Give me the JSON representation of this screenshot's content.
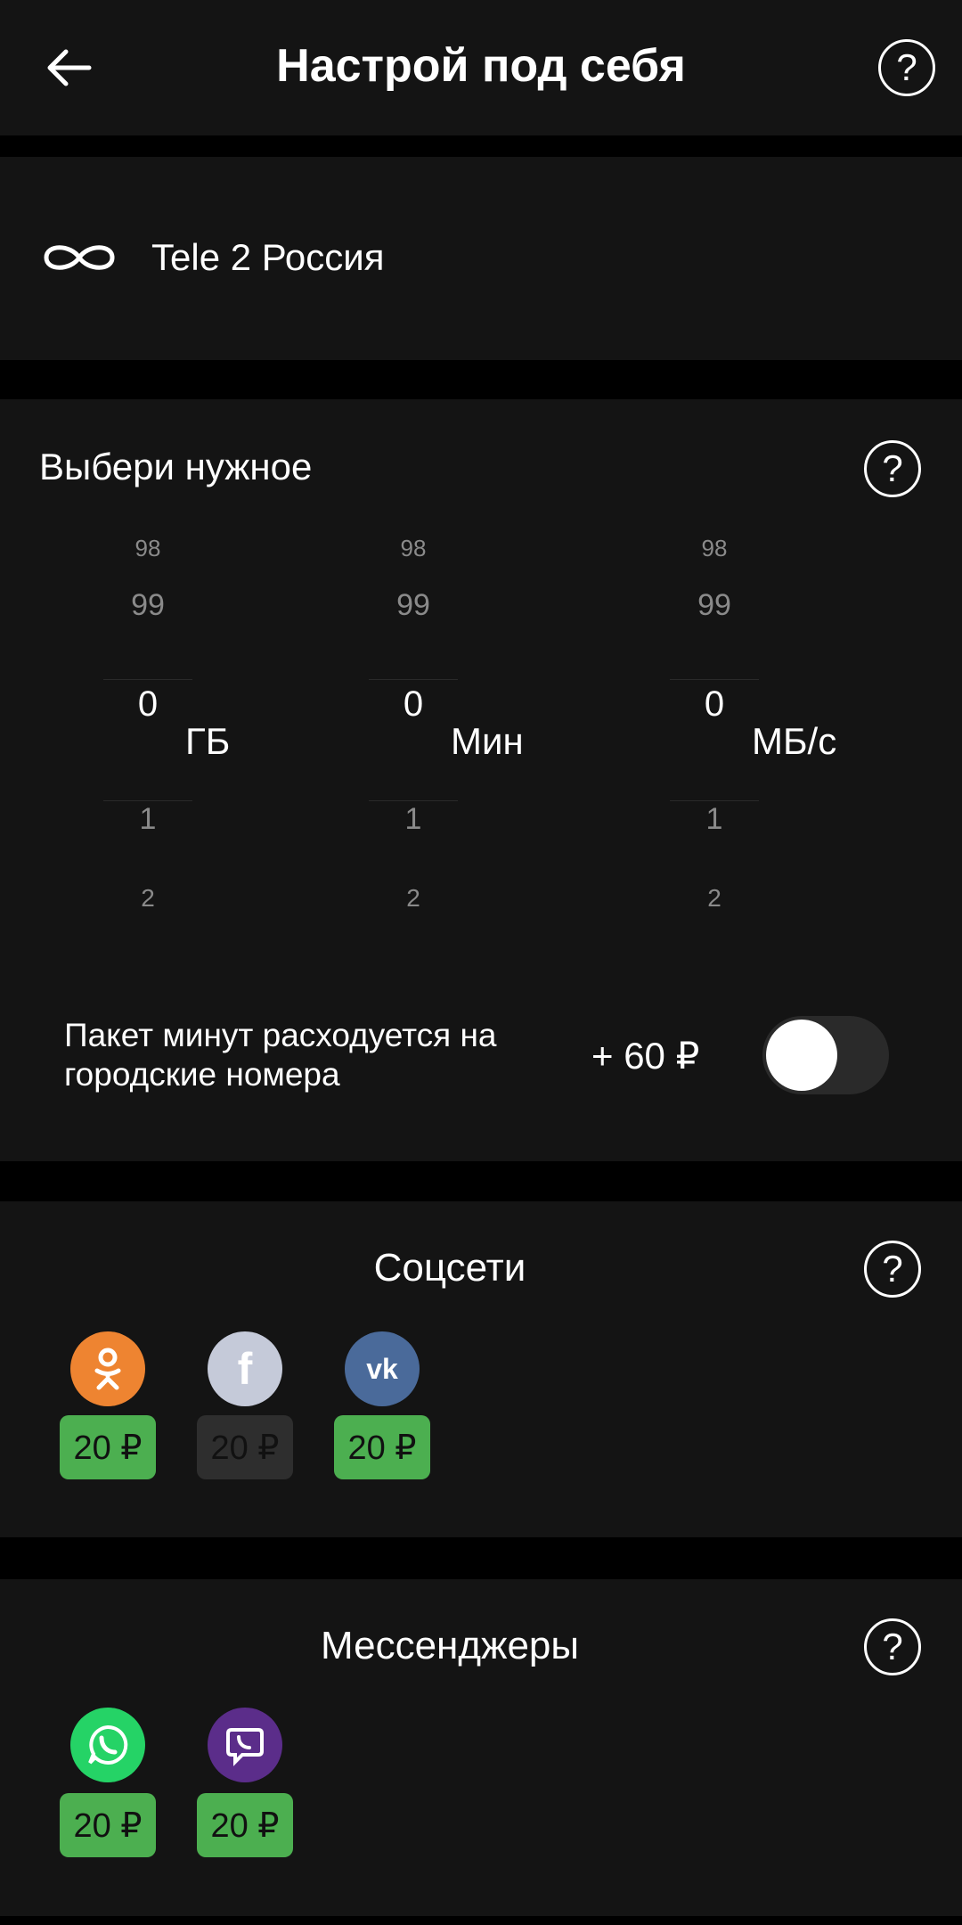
{
  "header": {
    "title": "Настрой под себя"
  },
  "operator": {
    "name": "Tele 2 Россия"
  },
  "builder": {
    "title": "Выбери нужное",
    "pickers": [
      {
        "unit": "ГБ",
        "values": [
          "98",
          "99",
          "0",
          "1",
          "2"
        ],
        "selected": "0"
      },
      {
        "unit": "Мин",
        "values": [
          "98",
          "99",
          "0",
          "1",
          "2"
        ],
        "selected": "0"
      },
      {
        "unit": "МБ/с",
        "values": [
          "98",
          "99",
          "0",
          "1",
          "2"
        ],
        "selected": "0"
      }
    ],
    "option_text": "Пакет минут расходуется на городские номера",
    "option_price": "+ 60 ₽",
    "option_enabled": false
  },
  "social": {
    "title": "Соцсети",
    "apps": [
      {
        "icon": "odnoklassniki-icon",
        "price": "20 ₽",
        "active": true,
        "color": "#EE8431"
      },
      {
        "icon": "facebook-icon",
        "price": "20 ₽",
        "active": false,
        "color": "#C5CAD9"
      },
      {
        "icon": "vk-icon",
        "price": "20 ₽",
        "active": true,
        "color": "#4A6A9A"
      }
    ]
  },
  "messengers": {
    "title": "Мессенджеры",
    "apps": [
      {
        "icon": "whatsapp-icon",
        "price": "20 ₽",
        "active": true,
        "color": "#25D366"
      },
      {
        "icon": "viber-icon",
        "price": "20 ₽",
        "active": true,
        "color": "#5B2D8A"
      }
    ]
  },
  "colors": {
    "chip_active": "#4CAF50",
    "chip_inactive": "#2E2E2E",
    "background": "#141414"
  }
}
